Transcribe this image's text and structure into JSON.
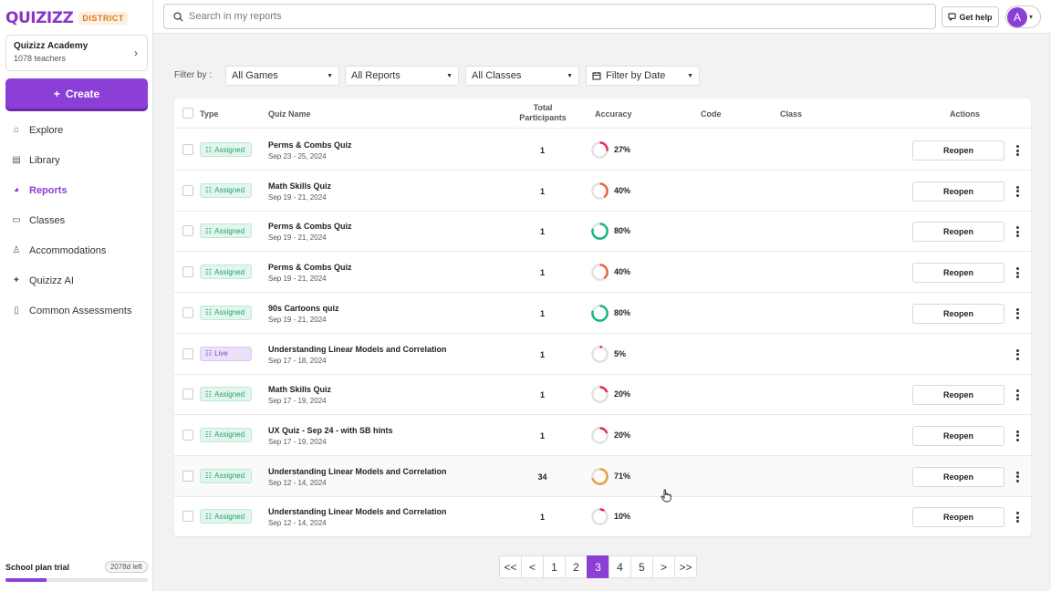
{
  "brand": {
    "name": "QUIZIZZ",
    "badge": "DISTRICT",
    "accent": "#8b3fd6"
  },
  "org": {
    "name": "Quizizz Academy",
    "teachers": "1078 teachers"
  },
  "create_label": "Create",
  "nav": [
    {
      "label": "Explore",
      "icon": "home-icon"
    },
    {
      "label": "Library",
      "icon": "library-icon"
    },
    {
      "label": "Reports",
      "icon": "reports-pie-icon",
      "active": true
    },
    {
      "label": "Classes",
      "icon": "classes-icon"
    },
    {
      "label": "Accommodations",
      "icon": "accommodations-icon"
    },
    {
      "label": "Quizizz AI",
      "icon": "sparkle-icon"
    },
    {
      "label": "Common Assessments",
      "icon": "clipboard-icon"
    }
  ],
  "trial": {
    "label": "School plan trial",
    "days_left": "2078d left",
    "progress": 0.29
  },
  "search": {
    "placeholder": "Search in my reports"
  },
  "help_label": "Get help",
  "avatar_letter": "A",
  "filters": {
    "label": "Filter by :",
    "games": "All Games",
    "reports": "All Reports",
    "classes": "All Classes",
    "date": "Filter by Date"
  },
  "columns": {
    "type": "Type",
    "quiz_name": "Quiz Name",
    "total_participants_1": "Total",
    "total_participants_2": "Participants",
    "accuracy": "Accuracy",
    "code": "Code",
    "class": "Class",
    "actions": "Actions"
  },
  "action_label": "Reopen",
  "rows": [
    {
      "type": "Assigned",
      "name": "Perms & Combs Quiz",
      "date": "Sep 23 - 25, 2024",
      "participants": "1",
      "accuracy": "27%",
      "acc_value": 27
    },
    {
      "type": "Assigned",
      "name": "Math Skills Quiz",
      "date": "Sep 19 - 21, 2024",
      "participants": "1",
      "accuracy": "40%",
      "acc_value": 40
    },
    {
      "type": "Assigned",
      "name": "Perms & Combs Quiz",
      "date": "Sep 19 - 21, 2024",
      "participants": "1",
      "accuracy": "80%",
      "acc_value": 80
    },
    {
      "type": "Assigned",
      "name": "Perms & Combs Quiz",
      "date": "Sep 19 - 21, 2024",
      "participants": "1",
      "accuracy": "40%",
      "acc_value": 40
    },
    {
      "type": "Assigned",
      "name": "90s Cartoons quiz",
      "date": "Sep 19 - 21, 2024",
      "participants": "1",
      "accuracy": "80%",
      "acc_value": 80
    },
    {
      "type": "Live",
      "name": "Understanding Linear Models and Correlation",
      "date": "Sep 17 - 18, 2024",
      "participants": "1",
      "accuracy": "5%",
      "acc_value": 5
    },
    {
      "type": "Assigned",
      "name": "Math Skills Quiz",
      "date": "Sep 17 - 19, 2024",
      "participants": "1",
      "accuracy": "20%",
      "acc_value": 20
    },
    {
      "type": "Assigned",
      "name": "UX Quiz - Sep 24 - with SB hints",
      "date": "Sep 17 - 19, 2024",
      "participants": "1",
      "accuracy": "20%",
      "acc_value": 20
    },
    {
      "type": "Assigned",
      "name": "Understanding Linear Models and Correlation",
      "date": "Sep 12 - 14, 2024",
      "participants": "34",
      "accuracy": "71%",
      "acc_value": 71,
      "hovered": true
    },
    {
      "type": "Assigned",
      "name": "Understanding Linear Models and Correlation",
      "date": "Sep 12 - 14, 2024",
      "participants": "1",
      "accuracy": "10%",
      "acc_value": 10
    }
  ],
  "pagination": {
    "first": "<<",
    "prev": "<",
    "pages": [
      "1",
      "2",
      "3",
      "4",
      "5"
    ],
    "current": "3",
    "next": ">",
    "last": ">>"
  }
}
